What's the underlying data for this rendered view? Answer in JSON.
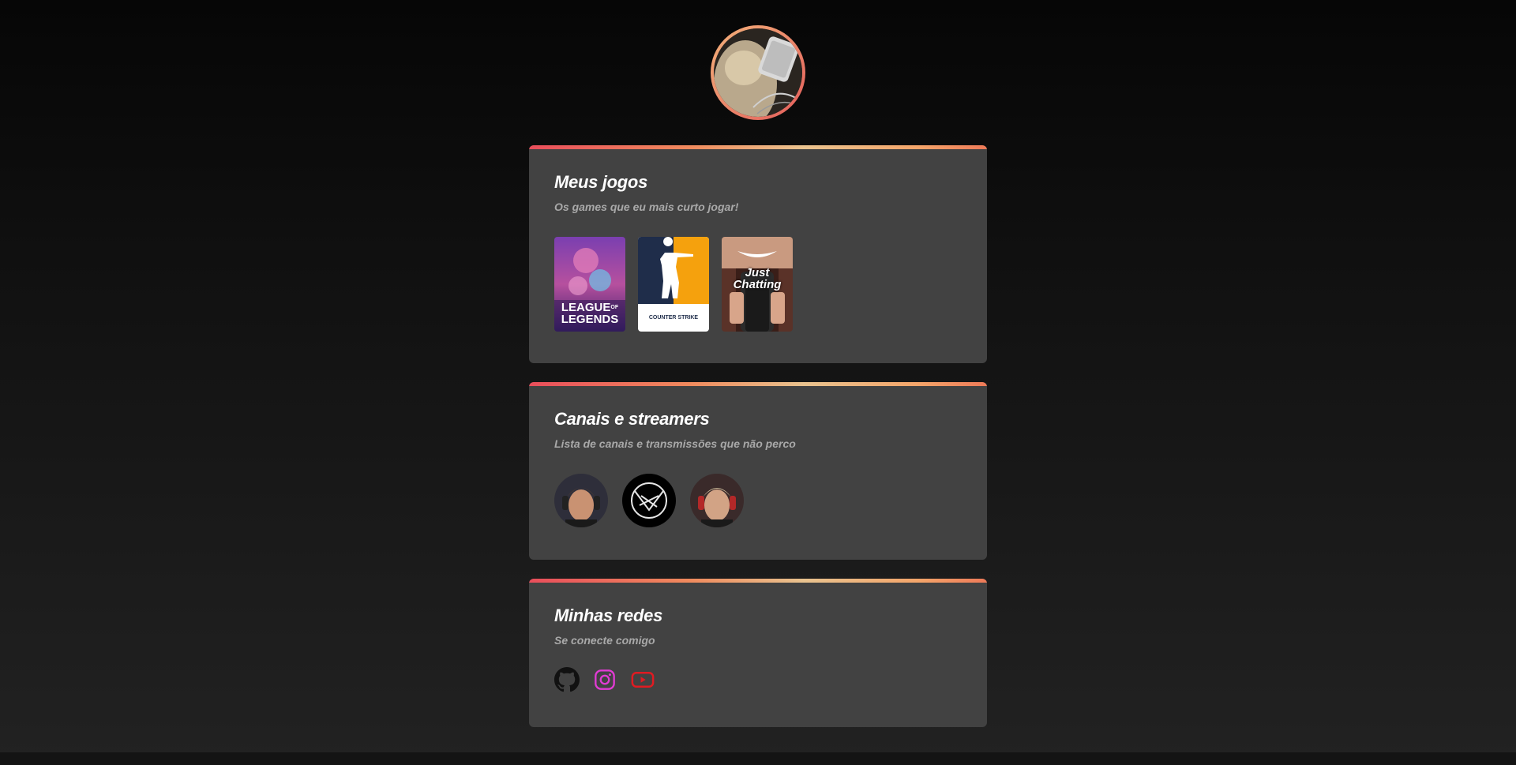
{
  "profile": {
    "avatar_alt": "avatar"
  },
  "sections": {
    "games": {
      "title": "Meus jogos",
      "subtitle": "Os games que eu mais curto jogar!",
      "items": [
        {
          "name": "League of Legends",
          "line1": "LEAGUE",
          "line2": "LEGENDS",
          "of": "OF"
        },
        {
          "name": "Counter Strike",
          "label": "COUNTER STRIKE"
        },
        {
          "name": "Just Chatting",
          "line1": "Just",
          "line2": "Chatting"
        }
      ]
    },
    "streamers": {
      "title": "Canais e streamers",
      "subtitle": "Lista de canais e transmissões que não perco",
      "items": [
        {
          "name": "streamer-1"
        },
        {
          "name": "streamer-2"
        },
        {
          "name": "streamer-3"
        }
      ]
    },
    "socials": {
      "title": "Minhas redes",
      "subtitle": "Se conecte comigo",
      "items": [
        {
          "name": "github",
          "icon": "github-icon",
          "color": "#111111"
        },
        {
          "name": "instagram",
          "icon": "instagram-icon",
          "color": "#e23bd4"
        },
        {
          "name": "youtube",
          "icon": "youtube-icon",
          "color": "#e01b22"
        }
      ]
    }
  },
  "colors": {
    "background_top": "#060606",
    "background_bottom": "#222222",
    "card": "#424242",
    "subtitle": "#a9a9a9",
    "accent_gradient": [
      "#e94e5b",
      "#f08a5d",
      "#e9c38f",
      "#f4a56a"
    ]
  }
}
